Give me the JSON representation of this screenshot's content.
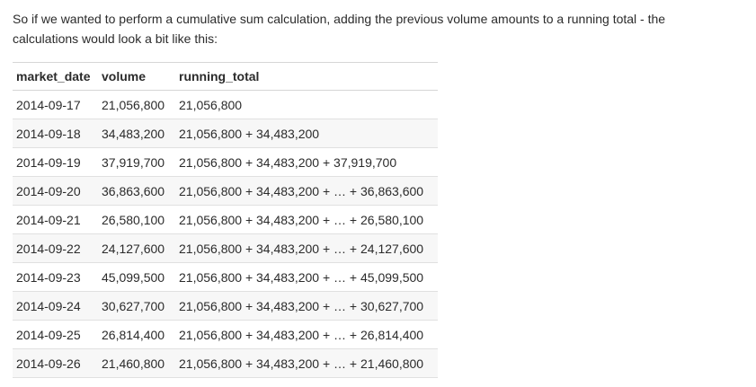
{
  "intro_text": "So if we wanted to perform a cumulative sum calculation, adding the previous volume amounts to a running total - the calculations would look a bit like this:",
  "table": {
    "headers": {
      "market_date": "market_date",
      "volume": "volume",
      "running_total": "running_total"
    },
    "rows": [
      {
        "market_date": "2014-09-17",
        "volume": "21,056,800",
        "running_total": "21,056,800"
      },
      {
        "market_date": "2014-09-18",
        "volume": "34,483,200",
        "running_total": "21,056,800 + 34,483,200"
      },
      {
        "market_date": "2014-09-19",
        "volume": "37,919,700",
        "running_total": "21,056,800 + 34,483,200 + 37,919,700"
      },
      {
        "market_date": "2014-09-20",
        "volume": "36,863,600",
        "running_total": "21,056,800 + 34,483,200 + … + 36,863,600"
      },
      {
        "market_date": "2014-09-21",
        "volume": "26,580,100",
        "running_total": "21,056,800 + 34,483,200 + … + 26,580,100"
      },
      {
        "market_date": "2014-09-22",
        "volume": "24,127,600",
        "running_total": "21,056,800 + 34,483,200 + … + 24,127,600"
      },
      {
        "market_date": "2014-09-23",
        "volume": "45,099,500",
        "running_total": "21,056,800 + 34,483,200 + … + 45,099,500"
      },
      {
        "market_date": "2014-09-24",
        "volume": "30,627,700",
        "running_total": "21,056,800 + 34,483,200 + … + 30,627,700"
      },
      {
        "market_date": "2014-09-25",
        "volume": "26,814,400",
        "running_total": "21,056,800 + 34,483,200 + … + 26,814,400"
      },
      {
        "market_date": "2014-09-26",
        "volume": "21,460,800",
        "running_total": "21,056,800 + 34,483,200 + … + 21,460,800"
      }
    ]
  }
}
